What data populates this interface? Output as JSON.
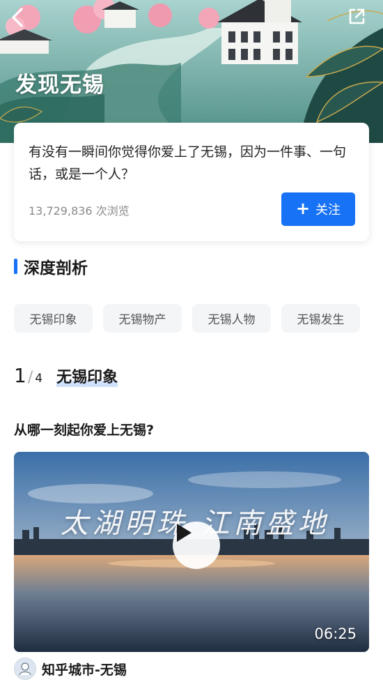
{
  "header": {
    "title": "发现无锡",
    "back_icon": "back-arrow-icon",
    "share_icon": "share-external-icon"
  },
  "question_card": {
    "text": "有没有一瞬间你觉得你爱上了无锡，因为一件事、一句话，或是一个人？",
    "views": "13,729,836 次浏览",
    "follow_label": "关注",
    "follow_icon": "plus-icon",
    "accent": "#1772f6"
  },
  "section": {
    "title": "深度剖析",
    "tabs": [
      {
        "label": "无锡印象"
      },
      {
        "label": "无锡物产"
      },
      {
        "label": "无锡人物"
      },
      {
        "label": "无锡发生"
      }
    ]
  },
  "carousel": {
    "current": "1",
    "separator": "/",
    "total": "4",
    "title": "无锡印象"
  },
  "video_item": {
    "question": "从哪一刻起你爱上无锡?",
    "caption": "太湖明珠 江南盛地",
    "duration": "06:25",
    "play_icon": "play-icon"
  },
  "author": {
    "name": "知乎城市-无锡",
    "avatar_icon": "avatar-icon"
  }
}
